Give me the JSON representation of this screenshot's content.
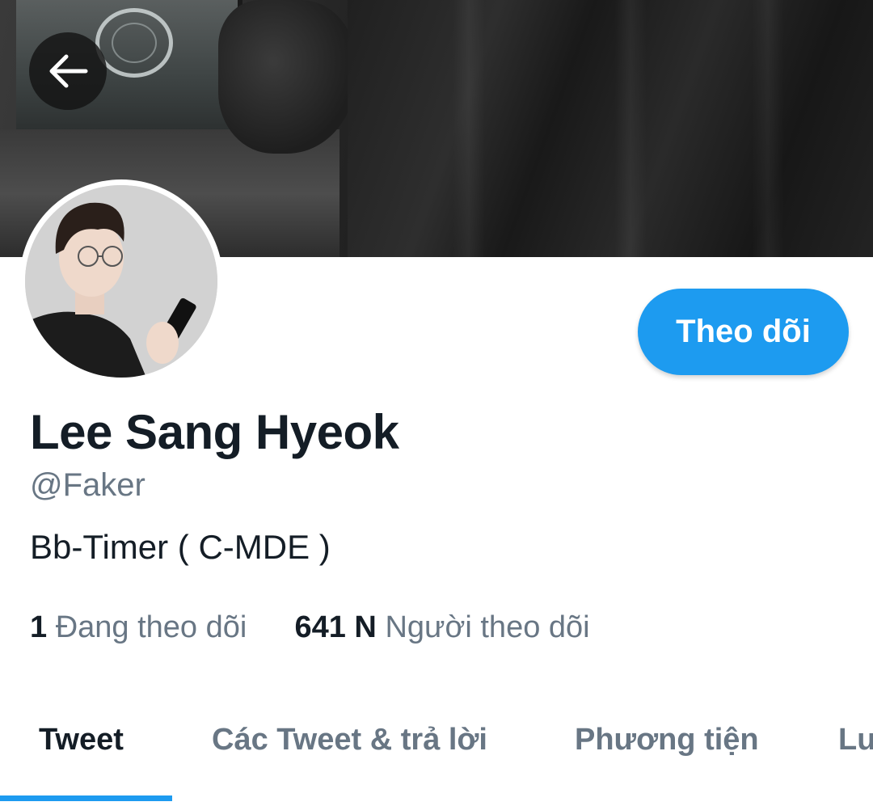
{
  "profile": {
    "name": "Lee Sang Hyeok",
    "handle": "@Faker",
    "bio": "Bb-Timer ( C-MDE )",
    "follow_label": "Theo dõi"
  },
  "stats": {
    "following_count": "1",
    "following_label": "Đang theo dõi",
    "followers_count": "641 N",
    "followers_label": "Người theo dõi"
  },
  "tabs": [
    {
      "label": "Tweet",
      "active": true
    },
    {
      "label": "Các Tweet & trả lời",
      "active": false
    },
    {
      "label": "Phương tiện",
      "active": false
    },
    {
      "label": "Lu",
      "active": false
    }
  ],
  "colors": {
    "accent": "#1d9bf0",
    "text_primary": "#141d26",
    "text_secondary": "#687684"
  },
  "icons": {
    "back": "arrow-left-icon"
  }
}
